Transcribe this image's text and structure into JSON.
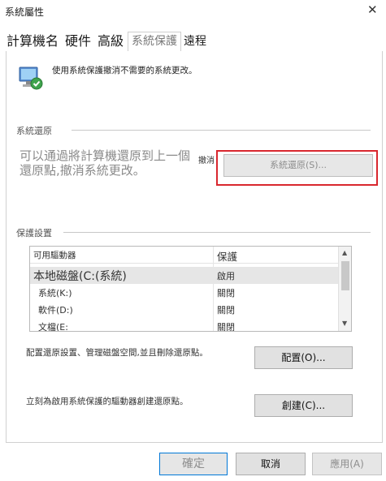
{
  "window": {
    "title": "系統屬性",
    "close_glyph": "✕"
  },
  "tabs": [
    {
      "label": "計算機名"
    },
    {
      "label": "硬件"
    },
    {
      "label": "高級"
    },
    {
      "label": "系統保護"
    },
    {
      "label": "遠程"
    }
  ],
  "intro": {
    "text": "使用系統保護撤消不需要的系統更改。"
  },
  "restore_group": {
    "label": "系統還原",
    "description": "可以通過將計算機還原到上一個還原點,撤消系統更改。",
    "truncated_text": "撤消",
    "button": "系統還原(S)..."
  },
  "protection_group": {
    "label": "保護設置",
    "list": {
      "headers": {
        "drive": "可用驅動器",
        "protection": "保護"
      },
      "rows": [
        {
          "drive": "本地磁盤(C:(系統)",
          "protection": "啟用"
        },
        {
          "drive": "系統(K:)",
          "protection": "關閉"
        },
        {
          "drive": "軟件(D:)",
          "protection": "關閉"
        },
        {
          "drive": "文檔(E:",
          "protection": "關閉"
        }
      ]
    },
    "configure_text": "配置還原設置、管理磁盤空間,並且刪除還原點。",
    "configure_button": "配置(O)...",
    "create_text": "立刻為啟用系統保護的驅動器創建還原點。",
    "create_button": "創建(C)..."
  },
  "footer": {
    "ok": "確定",
    "cancel": "取消",
    "apply": "應用(A)"
  },
  "colors": {
    "highlight": "#d9272e",
    "accent": "#0078d7"
  }
}
